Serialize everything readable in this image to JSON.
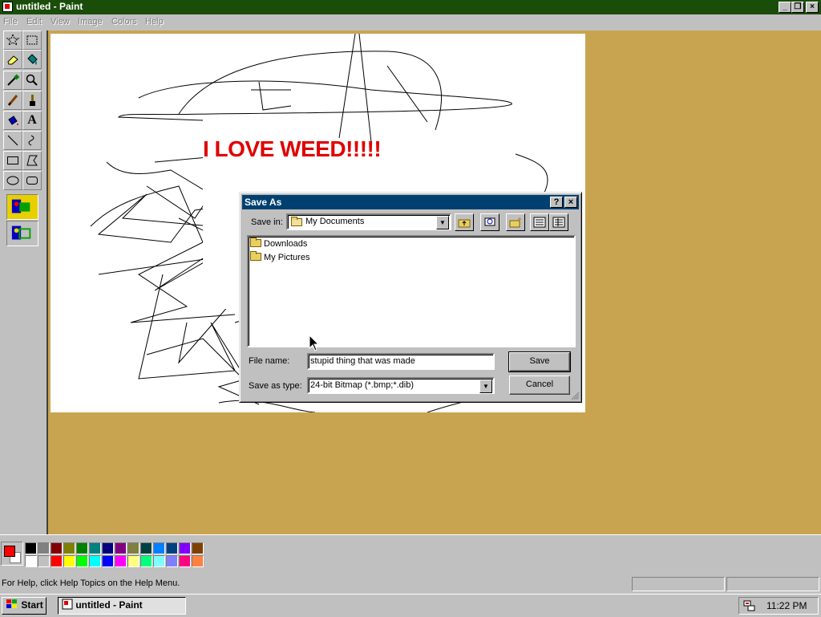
{
  "window": {
    "title": "untitled - Paint"
  },
  "menu": [
    "File",
    "Edit",
    "View",
    "Image",
    "Colors",
    "Help"
  ],
  "tools": [
    "free-select",
    "rect-select",
    "eraser",
    "fill-bucket",
    "color-picker",
    "magnifier",
    "pencil",
    "brush",
    "airbrush",
    "text",
    "line",
    "curve",
    "rectangle",
    "polygon",
    "ellipse",
    "rounded-rectangle"
  ],
  "canvas": {
    "text": "I LOVE WEED!!!!!",
    "text_color": "#e00000"
  },
  "dialog": {
    "title": "Save As",
    "help_label": "?",
    "close_label": "×",
    "save_in_label": "Save in:",
    "save_in_value": "My Documents",
    "items": [
      "Downloads",
      "My Pictures"
    ],
    "file_name_label": "File name:",
    "file_name_value": "stupid thing that was made",
    "save_type_label": "Save as type:",
    "save_type_value": "24-bit Bitmap (*.bmp;*.dib)",
    "save_button": "Save",
    "cancel_button": "Cancel"
  },
  "palette": {
    "foreground": "#ff0000",
    "background": "#ffffff",
    "row1": [
      "#000000",
      "#808080",
      "#800000",
      "#808000",
      "#008000",
      "#008080",
      "#000080",
      "#800080",
      "#808040",
      "#004040",
      "#0080ff",
      "#004080",
      "#8000ff",
      "#804000"
    ],
    "row2": [
      "#ffffff",
      "#c0c0c0",
      "#ff0000",
      "#ffff00",
      "#00ff00",
      "#00ffff",
      "#0000ff",
      "#ff00ff",
      "#ffff80",
      "#00ff80",
      "#80ffff",
      "#8080ff",
      "#ff0080",
      "#ff8040"
    ]
  },
  "status": {
    "help_text": "For Help, click Help Topics on the Help Menu."
  },
  "taskbar": {
    "start_label": "Start",
    "task_label": "untitled - Paint",
    "clock": "11:22 PM"
  }
}
